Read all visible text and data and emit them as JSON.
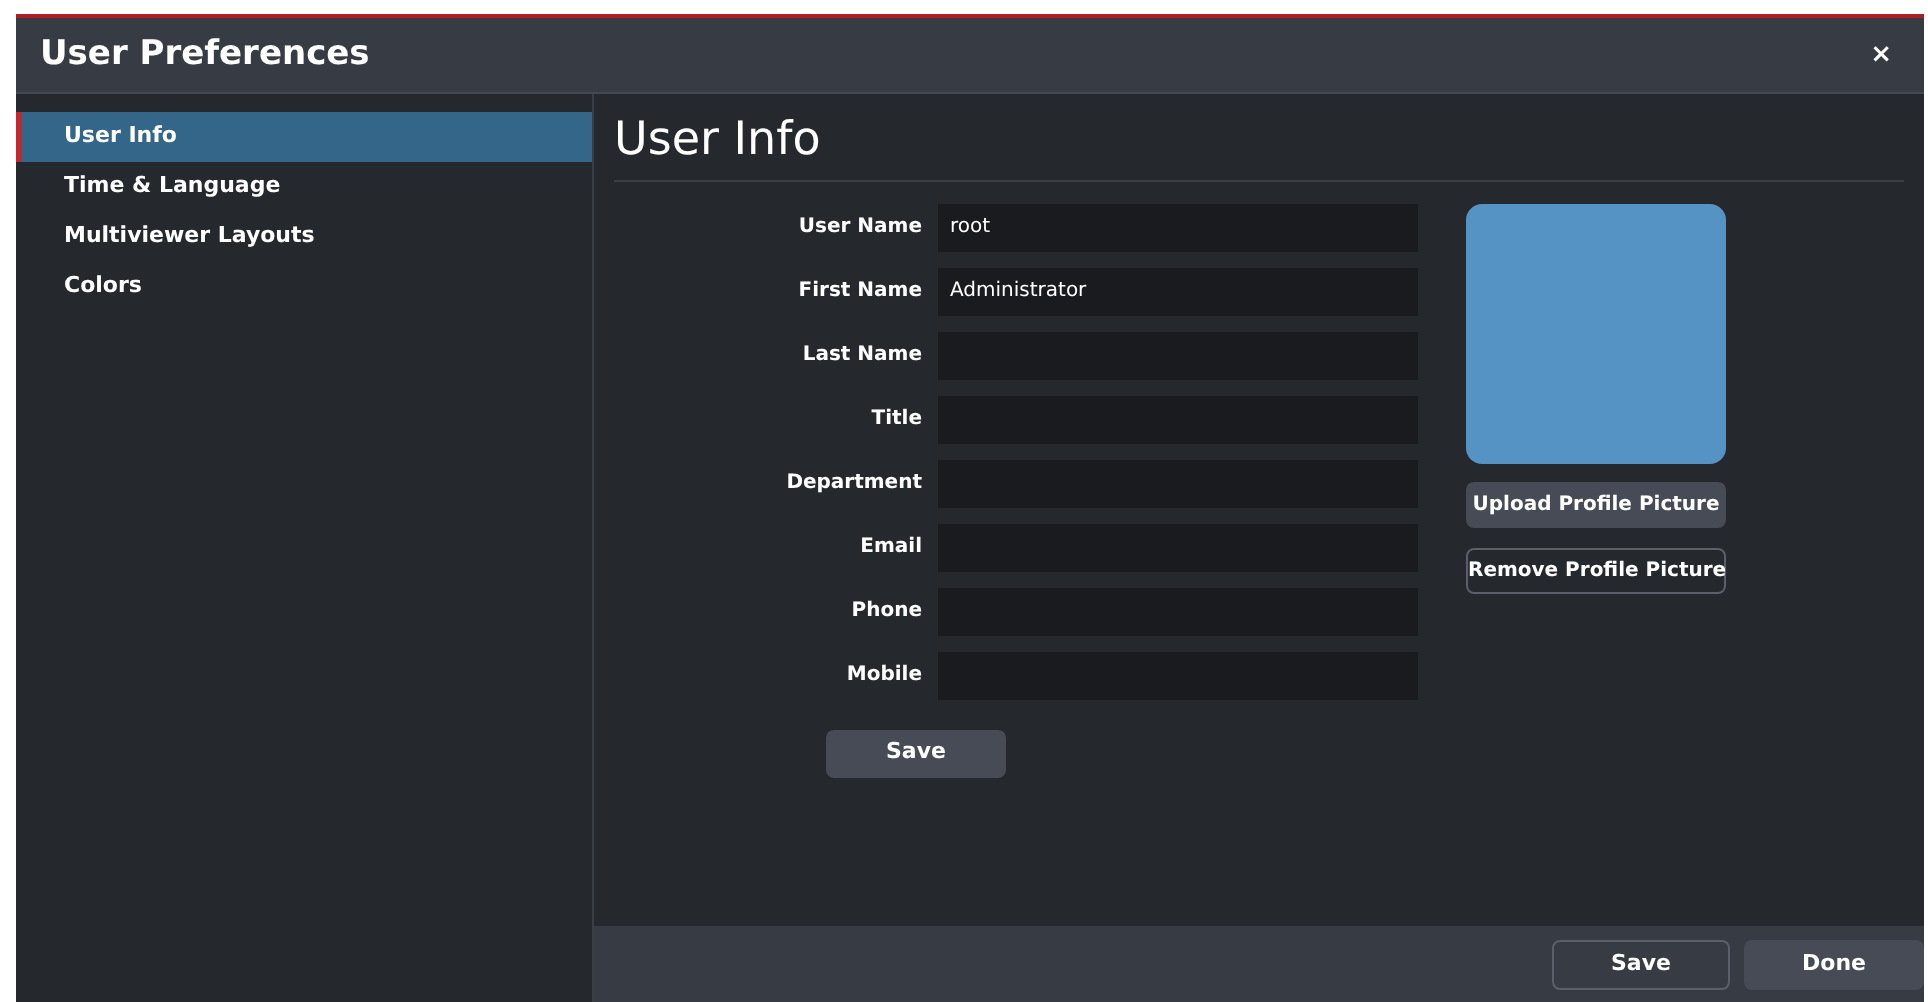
{
  "window": {
    "title": "User Preferences",
    "close": "×"
  },
  "sidebar": {
    "items": [
      {
        "label": "User Info",
        "selected": true
      },
      {
        "label": "Time & Language",
        "selected": false
      },
      {
        "label": "Multiviewer Layouts",
        "selected": false
      },
      {
        "label": "Colors",
        "selected": false
      }
    ]
  },
  "heading": "User Info",
  "fields": [
    {
      "label": "User Name",
      "value": "root"
    },
    {
      "label": "First Name",
      "value": "Administrator"
    },
    {
      "label": "Last Name"
    },
    {
      "label": "Title"
    },
    {
      "label": "Department"
    },
    {
      "label": "Email"
    },
    {
      "label": "Phone"
    },
    {
      "label": "Mobile"
    }
  ],
  "form_button": "Save",
  "profile": {
    "upload_button": "Upload Profile Picture",
    "remove_button": "Remove Profile Picture"
  },
  "footer": {
    "buttons": [
      {
        "label": "Save",
        "kind": "outline"
      },
      {
        "label": "Done",
        "kind": "filled"
      }
    ]
  }
}
